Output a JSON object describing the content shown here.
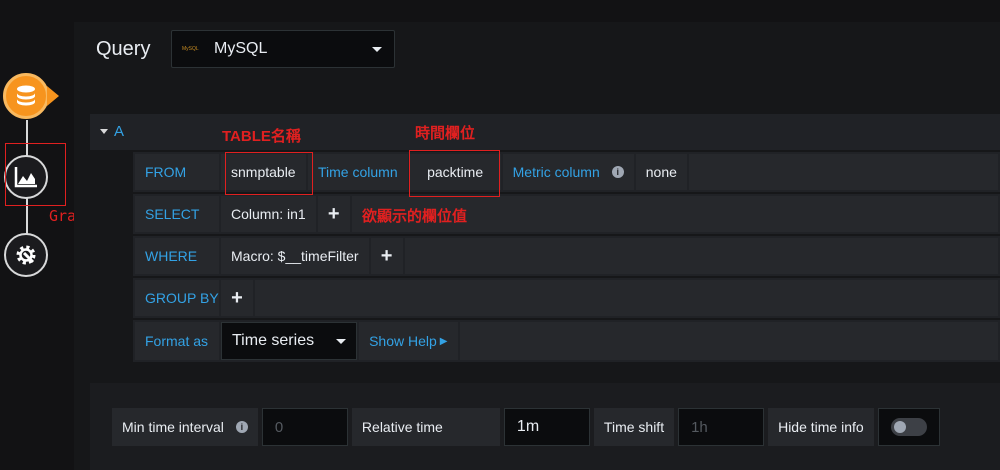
{
  "query": {
    "label": "Query",
    "datasource_logo_text": "MySQL",
    "datasource": "MySQL"
  },
  "query_row": {
    "label": "A"
  },
  "builder": {
    "from": {
      "keyword": "FROM",
      "table": "snmptable",
      "time_column_label": "Time column",
      "time_column": "packtime",
      "metric_column_label": "Metric column",
      "metric_column": "none"
    },
    "select": {
      "keyword": "SELECT",
      "column": "Column: in1"
    },
    "where": {
      "keyword": "WHERE",
      "macro": "Macro: $__timeFilter"
    },
    "group_by": {
      "keyword": "GROUP BY"
    },
    "format": {
      "keyword": "Format as",
      "value": "Time series",
      "show_help": "Show Help"
    },
    "plus": "+"
  },
  "annotations": {
    "table_name": "TABLE名稱",
    "time_field": "時間欄位",
    "display_field": "欲顯示的欄位值",
    "graph": "Graph"
  },
  "options": {
    "min_interval_label": "Min time interval",
    "min_interval_placeholder": "0",
    "relative_time_label": "Relative time",
    "relative_time_value": "1m",
    "time_shift_label": "Time shift",
    "time_shift_placeholder": "1h",
    "hide_time_info_label": "Hide time info",
    "hide_time_info": false
  },
  "colors": {
    "accent": "#33a2e5",
    "annotation": "#e02020",
    "datasource_active": "#f7941e"
  },
  "icons": {
    "datasource": "database-icon",
    "visualization": "graph-icon",
    "settings": "gear-icon"
  }
}
